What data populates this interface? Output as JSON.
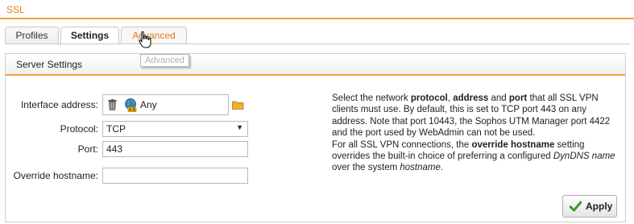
{
  "page": {
    "title": "SSL"
  },
  "tabs": [
    {
      "label": "Profiles"
    },
    {
      "label": "Settings"
    },
    {
      "label": "Advanced"
    }
  ],
  "tooltip": {
    "text": "Advanced"
  },
  "panel": {
    "title": "Server Settings"
  },
  "form": {
    "interface_label": "Interface address:",
    "interface_value": "Any",
    "protocol_label": "Protocol:",
    "protocol_value": "TCP",
    "port_label": "Port:",
    "port_value": "443",
    "hostname_label": "Override hostname:",
    "hostname_value": ""
  },
  "help": {
    "p1_a": "Select the network ",
    "p1_protocol": "protocol",
    "p1_b": ", ",
    "p1_address": "address",
    "p1_c": " and ",
    "p1_port": "port",
    "p1_d": " that all SSL VPN clients must use. By default, this is set to TCP port 443 on any address. Note that port 10443, the Sophos UTM Manager port 4422 and the port used by WebAdmin can not be used.",
    "p2_a": "For all SSL VPN connections, the ",
    "p2_override": "override hostname",
    "p2_b": " setting overrides the built-in choice of preferring a configured ",
    "p2_dyndns": "DynDNS name",
    "p2_c": " over the system ",
    "p2_hostname": "hostname",
    "p2_d": "."
  },
  "buttons": {
    "apply_label": "Apply"
  },
  "colors": {
    "accent": "#f0a040",
    "tab_active_text": "#e07b1a",
    "check_green": "#3a9a2a"
  },
  "icons": [
    "trash-icon",
    "globe-icon",
    "folder-icon",
    "hand-cursor-icon",
    "check-icon",
    "chevron-down-icon"
  ]
}
